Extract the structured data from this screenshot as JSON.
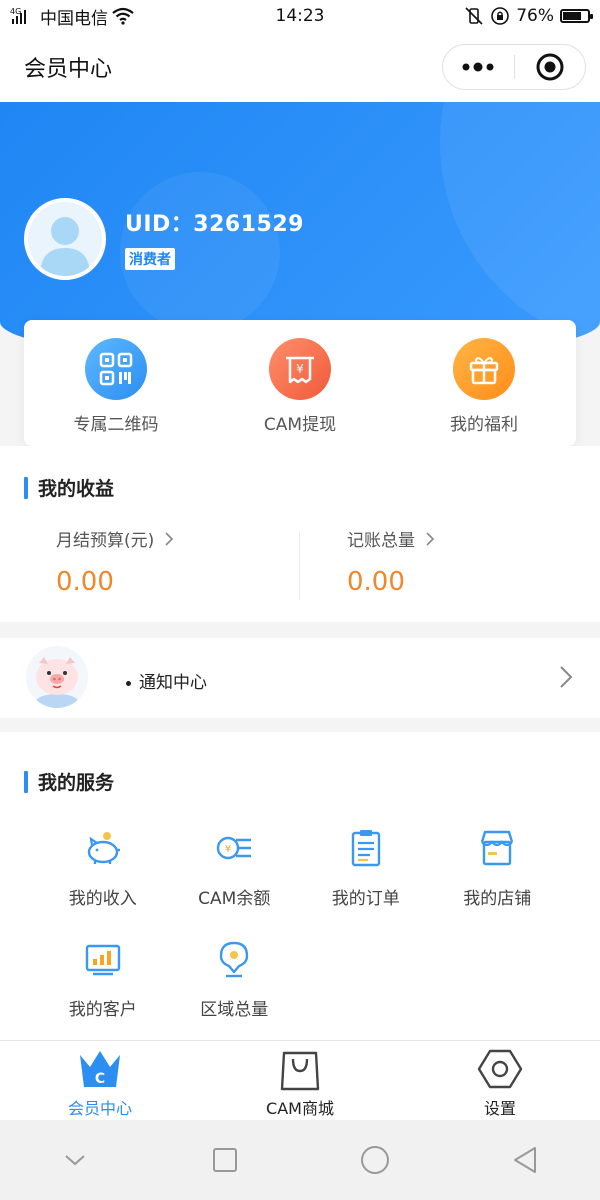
{
  "status_bar": {
    "network_type": "4G",
    "carrier": "中国电信",
    "time": "14:23",
    "battery_percent": "76%",
    "battery_level": 0.76
  },
  "nav": {
    "title": "会员中心"
  },
  "profile": {
    "uid_text": "UID：3261529",
    "role": "消费者"
  },
  "quick_actions": [
    {
      "label": "专属二维码",
      "icon": "qr-code-icon",
      "color": "#2b8ef0"
    },
    {
      "label": "CAM提现",
      "icon": "receipt-yen-icon",
      "color": "#f05a3a"
    },
    {
      "label": "我的福利",
      "icon": "gift-icon",
      "color": "#ff8d1a"
    }
  ],
  "earnings": {
    "title": "我的收益",
    "left": {
      "label": "月结预算(元)",
      "value": "0.00"
    },
    "right": {
      "label": "记账总量",
      "value": "0.00"
    },
    "value_color": "#f2872a"
  },
  "notice": {
    "label": "通知中心"
  },
  "services": {
    "title": "我的服务",
    "items": [
      {
        "label": "我的收入",
        "icon": "piggy-bank-icon"
      },
      {
        "label": "CAM余额",
        "icon": "coin-balance-icon"
      },
      {
        "label": "我的订单",
        "icon": "order-list-icon"
      },
      {
        "label": "我的店铺",
        "icon": "shop-icon"
      },
      {
        "label": "我的客户",
        "icon": "customer-chart-icon"
      },
      {
        "label": "区域总量",
        "icon": "region-pin-icon"
      }
    ]
  },
  "tabs": [
    {
      "label": "会员中心",
      "icon": "crown-icon",
      "active": true
    },
    {
      "label": "CAM商城",
      "icon": "shopping-bag-icon",
      "active": false
    },
    {
      "label": "设置",
      "icon": "hex-settings-icon",
      "active": false
    }
  ],
  "colors": {
    "primary": "#2b8ef0",
    "accent_orange": "#f2872a"
  }
}
